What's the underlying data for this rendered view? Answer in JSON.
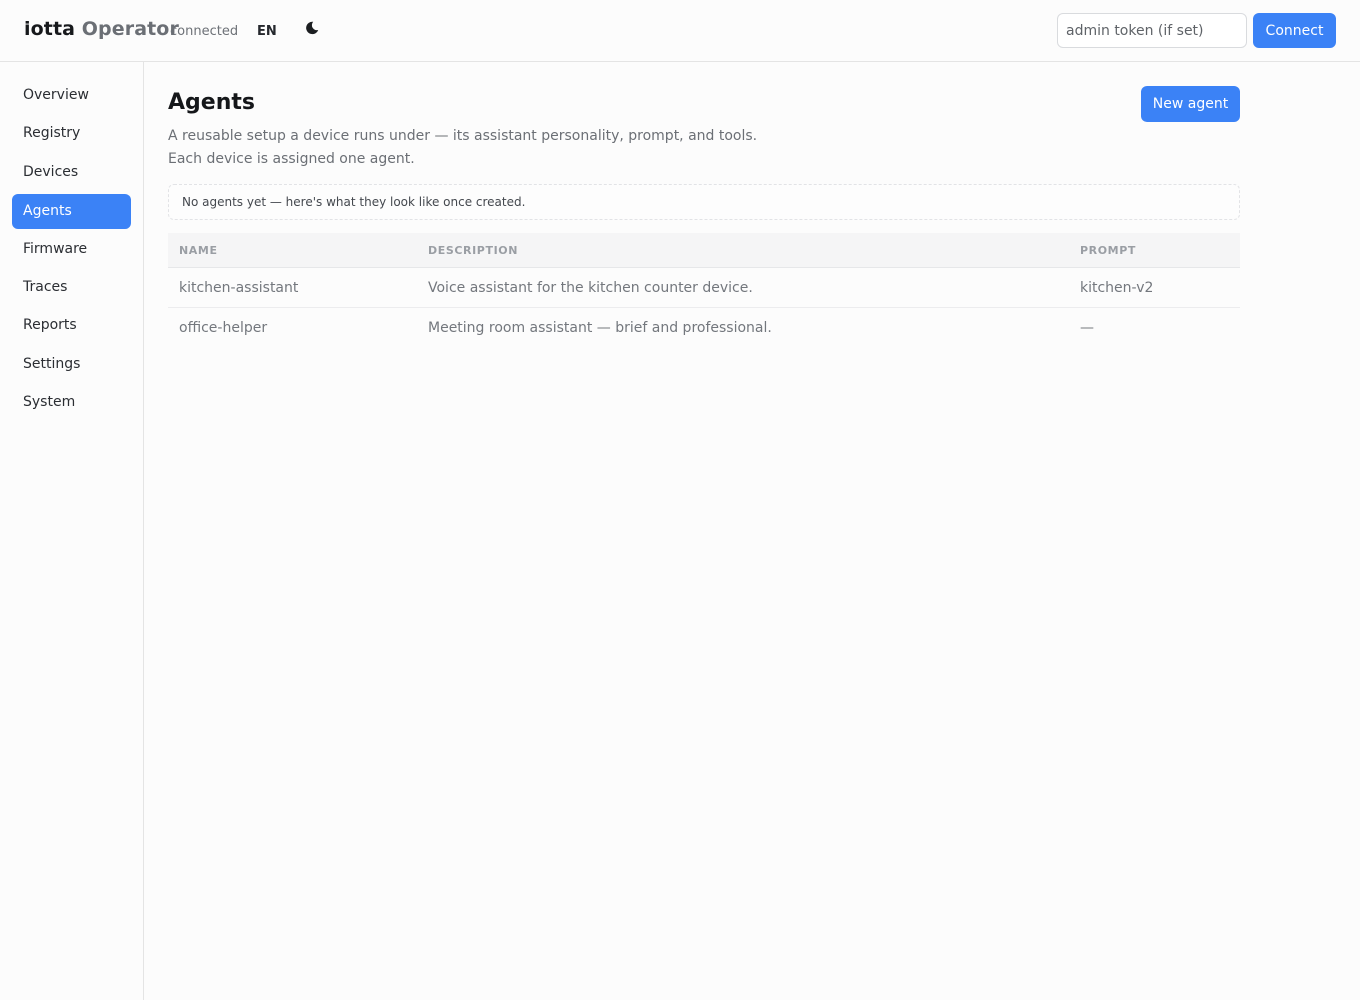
{
  "header": {
    "brand_primary": "iotta",
    "brand_secondary": "Operator",
    "connection_status": "connected",
    "language": "EN",
    "theme_icon": "moon-icon",
    "token_placeholder": "admin token (if set)",
    "connect_label": "Connect"
  },
  "sidebar": {
    "items": [
      {
        "label": "Overview"
      },
      {
        "label": "Registry"
      },
      {
        "label": "Devices"
      },
      {
        "label": "Agents",
        "active": true
      },
      {
        "label": "Firmware"
      },
      {
        "label": "Traces"
      },
      {
        "label": "Reports"
      },
      {
        "label": "Settings"
      },
      {
        "label": "System"
      }
    ]
  },
  "main": {
    "title": "Agents",
    "description_line1": "A reusable setup a device runs under — its assistant personality, prompt, and tools.",
    "description_line2": "Each device is assigned one agent.",
    "new_button_label": "New agent",
    "empty_note": "No agents yet — here's what they look like once created.",
    "table": {
      "columns": [
        "NAME",
        "DESCRIPTION",
        "PROMPT"
      ],
      "rows": [
        {
          "name": "kitchen-assistant",
          "description": "Voice assistant for the kitchen counter device.",
          "prompt": "kitchen-v2"
        },
        {
          "name": "office-helper",
          "description": "Meeting room assistant — brief and professional.",
          "prompt": "—"
        }
      ]
    }
  },
  "colors": {
    "accent": "#3b82f6",
    "background": "#fcfcfc",
    "border": "#e4e4e4"
  }
}
